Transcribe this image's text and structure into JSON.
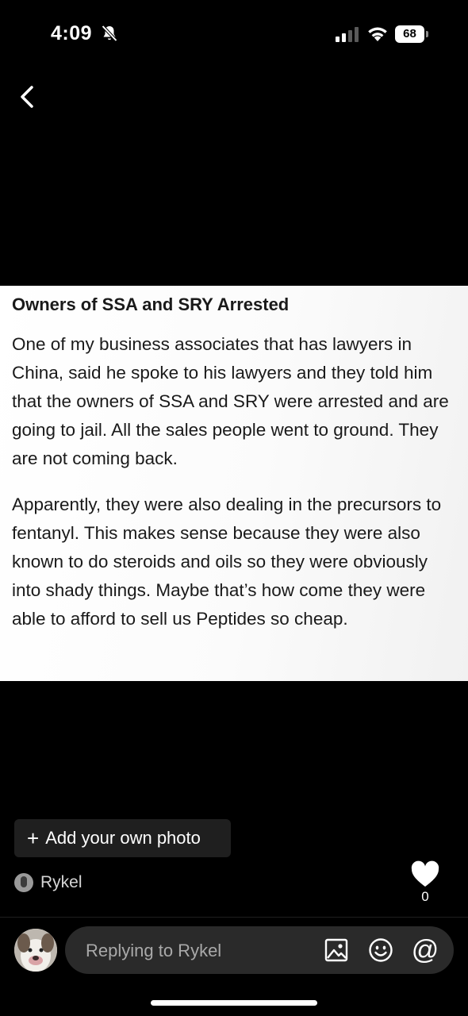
{
  "status_bar": {
    "time": "4:09",
    "battery": "68",
    "icons": [
      "bell-muted-icon",
      "signal-icon",
      "wifi-icon",
      "battery-icon"
    ]
  },
  "nav": {
    "back_icon": "chevron-left-icon"
  },
  "post": {
    "title": "Owners of SSA and SRY Arrested",
    "paragraphs": [
      "One of my business associates that has lawyers in China, said he spoke to his lawyers and they told him that the owners of SSA and SRY were arrested and are going to jail. All the sales people went to ground. They are not coming back.",
      "Apparently, they were also dealing in the precursors to fentanyl. This makes sense because they were also known to do steroids and oils so they were obviously into shady things. Maybe that’s how come they were able to afford to sell us Peptides so cheap."
    ]
  },
  "actions": {
    "add_photo_plus": "+",
    "add_photo_label": "Add your own photo"
  },
  "author": {
    "name": "Rykel"
  },
  "likes": {
    "count": "0",
    "icon": "heart-icon"
  },
  "reply": {
    "placeholder": "Replying to Rykel",
    "icons": [
      "image-icon",
      "emoji-icon",
      "at-mention-icon"
    ],
    "mention_glyph": "@"
  },
  "colors": {
    "background": "#000000",
    "card": "#ffffff",
    "reply_bar": "#2a2a2a",
    "add_photo_bg": "#1f1f1f"
  }
}
